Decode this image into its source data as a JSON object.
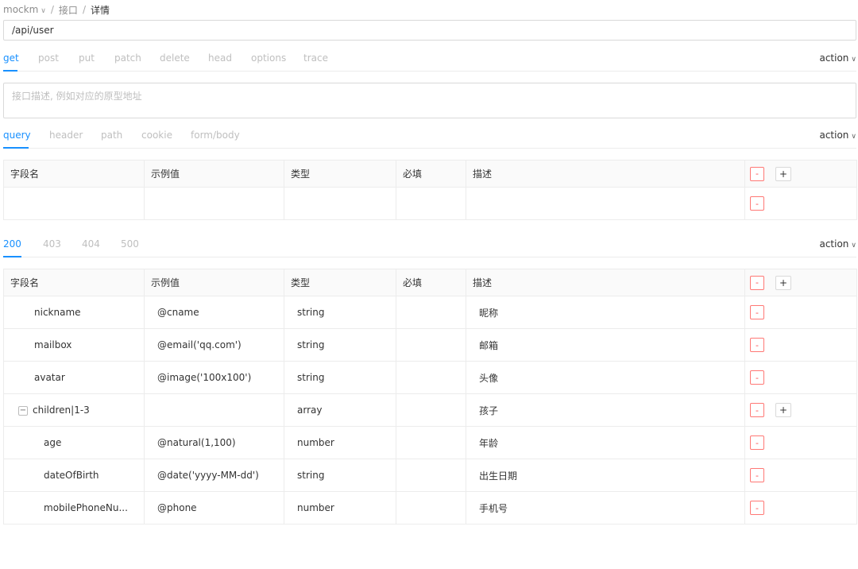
{
  "breadcrumb": {
    "project": "mockm",
    "section": "接口",
    "current": "详情"
  },
  "path": {
    "value": "/api/user"
  },
  "methods": {
    "tabs": [
      "get",
      "post",
      "put",
      "patch",
      "delete",
      "head",
      "options",
      "trace"
    ],
    "active": "get",
    "action_label": "action"
  },
  "description": {
    "placeholder": "接口描述, 例如对应的原型地址"
  },
  "request": {
    "tabs": [
      "query",
      "header",
      "path",
      "cookie",
      "form/body"
    ],
    "active": "query",
    "action_label": "action",
    "table": {
      "headers": [
        "字段名",
        "示例值",
        "类型",
        "必填",
        "描述"
      ],
      "rows": [
        {
          "name": "",
          "example": "",
          "type": "",
          "required": "",
          "desc": ""
        }
      ]
    }
  },
  "response": {
    "tabs": [
      "200",
      "403",
      "404",
      "500"
    ],
    "active": "200",
    "action_label": "action",
    "table": {
      "headers": [
        "字段名",
        "示例值",
        "类型",
        "必填",
        "描述"
      ],
      "rows": [
        {
          "name": "nickname",
          "example": "@cname",
          "type": "string",
          "required": "",
          "desc": "昵称",
          "level": 1
        },
        {
          "name": "mailbox",
          "example": "@email('qq.com')",
          "type": "string",
          "required": "",
          "desc": "邮箱",
          "level": 1
        },
        {
          "name": "avatar",
          "example": "@image('100x100')",
          "type": "string",
          "required": "",
          "desc": "头像",
          "level": 1
        },
        {
          "name": "children|1-3",
          "example": "",
          "type": "array",
          "required": "",
          "desc": "孩子",
          "level": 1,
          "expandable": true
        },
        {
          "name": "age",
          "example": "@natural(1,100)",
          "type": "number",
          "required": "",
          "desc": "年龄",
          "level": 2
        },
        {
          "name": "dateOfBirth",
          "example": "@date('yyyy-MM-dd')",
          "type": "string",
          "required": "",
          "desc": "出生日期",
          "level": 2
        },
        {
          "name": "mobilePhoneNu...",
          "example": "@phone",
          "type": "number",
          "required": "",
          "desc": "手机号",
          "level": 2
        }
      ]
    }
  },
  "buttons": {
    "minus": "-",
    "plus": "+",
    "collapse": "−"
  },
  "glyphs": {
    "chevron_down": "∨",
    "separator": "/"
  },
  "colors": {
    "accent": "#1890ff",
    "danger": "#ff4d4f",
    "muted": "#bfbfbf",
    "border": "#ececec",
    "header_bg": "#fafafa"
  }
}
